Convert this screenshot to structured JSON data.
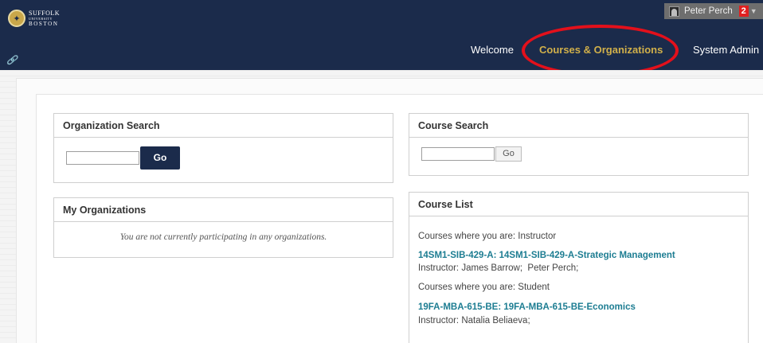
{
  "header": {
    "logo": {
      "line1": "SUFFOLK",
      "line2": "UNIVERSITY",
      "line3": "BOSTON"
    },
    "user": {
      "name": "Peter Perch",
      "notification_count": "2"
    },
    "nav": {
      "welcome": "Welcome",
      "courses": "Courses & Organizations",
      "system_admin": "System Admin"
    },
    "highlight_color": "#e3101b",
    "accent_color": "#d1b04a",
    "header_color": "#1b2b4b"
  },
  "organization_search": {
    "title": "Organization Search",
    "input_value": "",
    "go_label": "Go"
  },
  "course_search": {
    "title": "Course Search",
    "input_value": "",
    "go_label": "Go"
  },
  "my_organizations": {
    "title": "My Organizations",
    "empty_message": "You are not currently participating in any organizations."
  },
  "course_list": {
    "title": "Course List",
    "groups": [
      {
        "heading": "Courses where you are: Instructor",
        "course": "14SM1-SIB-429-A: 14SM1-SIB-429-A-Strategic Management",
        "instructors_label": "Instructor:",
        "instructors": "James Barrow;  Peter Perch;"
      },
      {
        "heading": "Courses where you are: Student",
        "course": "19FA-MBA-615-BE: 19FA-MBA-615-BE-Economics",
        "instructors_label": "Instructor:",
        "instructors": "Natalia Beliaeva;"
      }
    ],
    "link_color": "#1d7d92"
  }
}
